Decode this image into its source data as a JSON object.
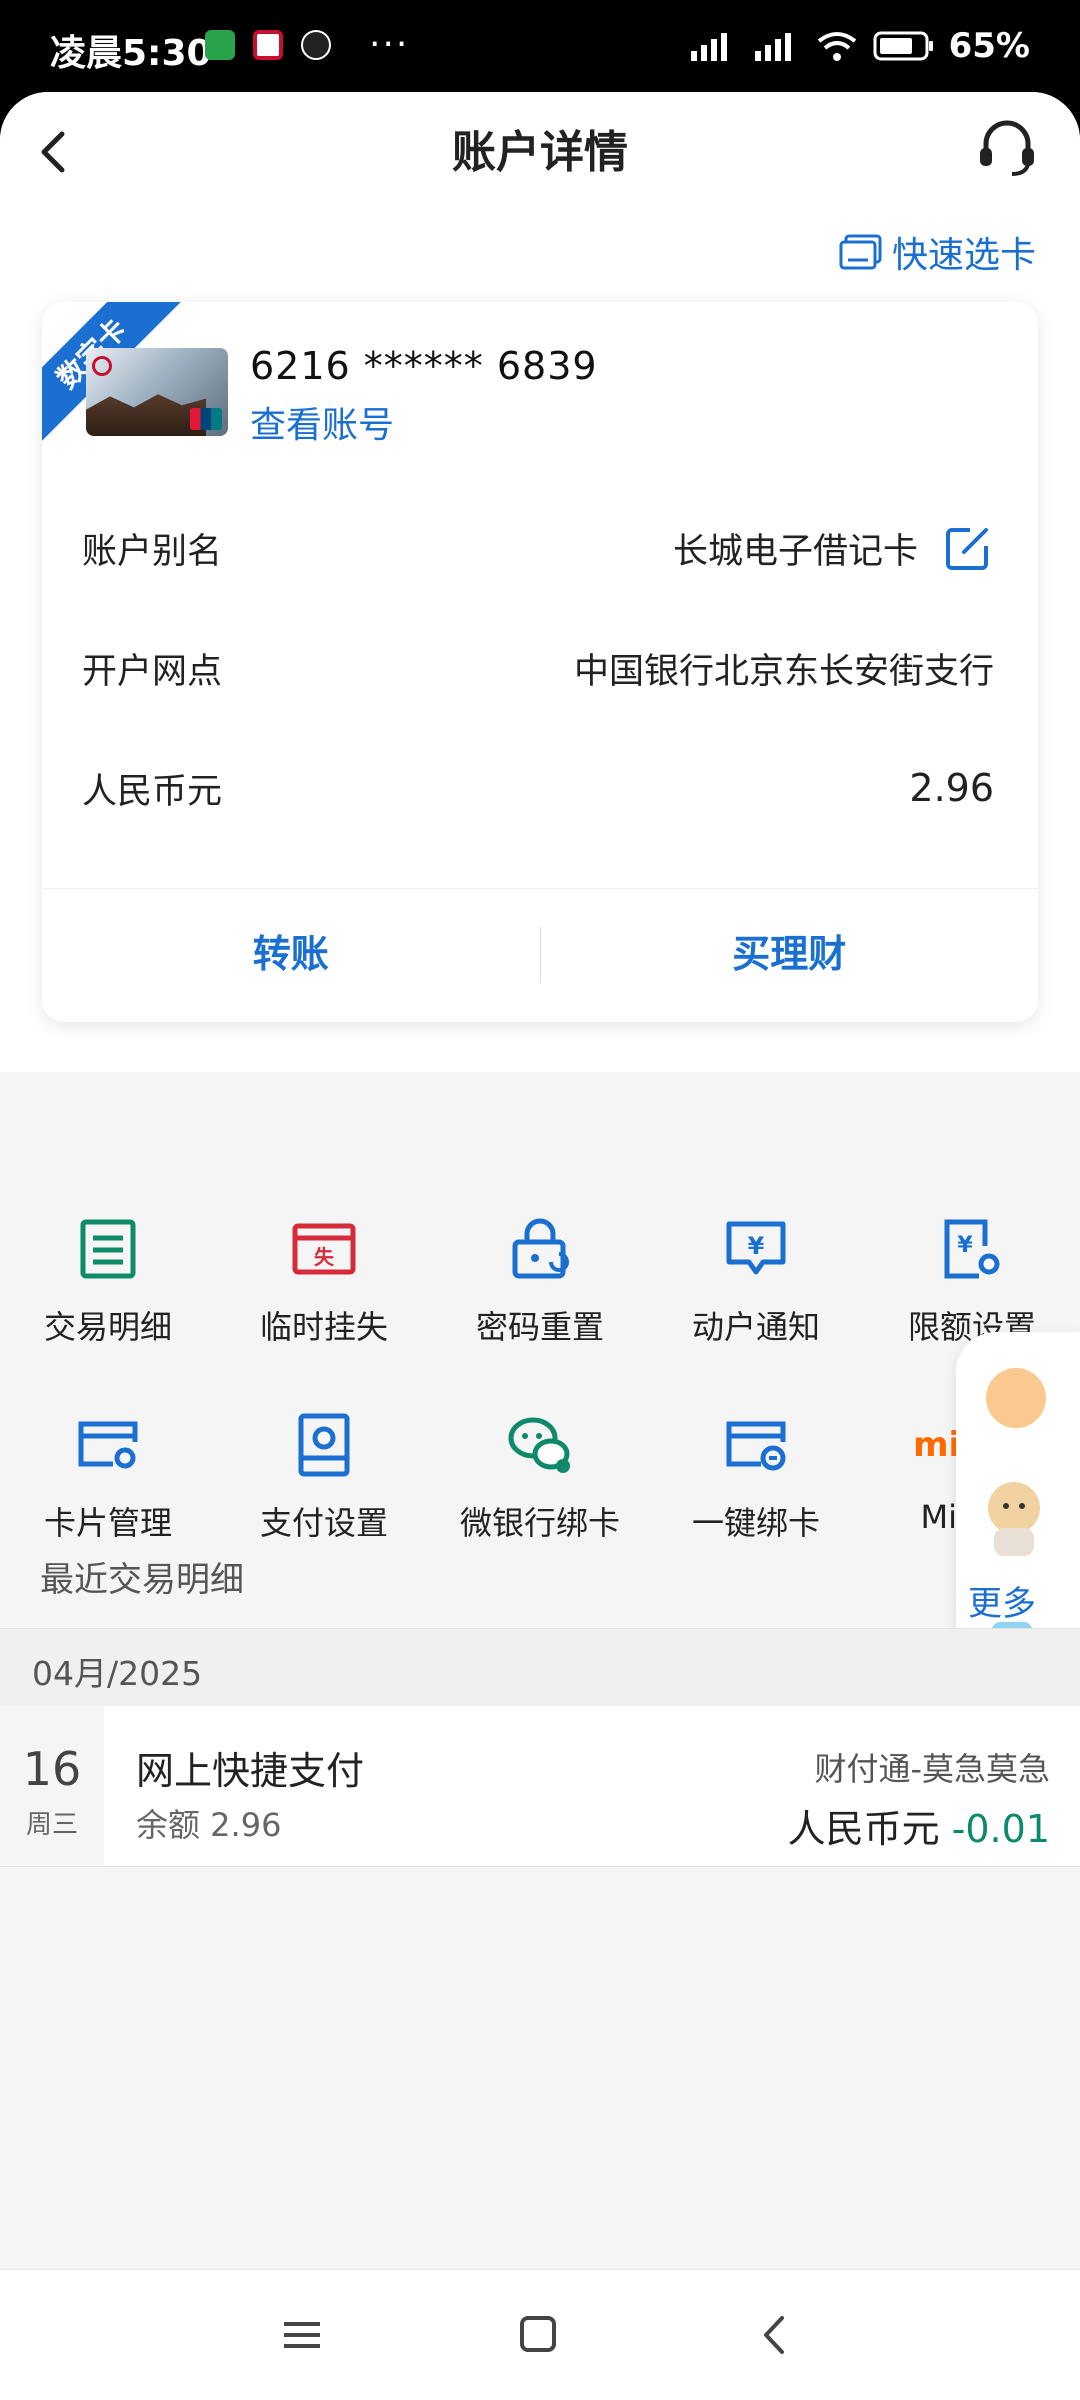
{
  "status_bar": {
    "time": "凌晨5:30",
    "battery": "65%"
  },
  "header": {
    "title": "账户详情",
    "quick_pick": "快速选卡"
  },
  "card": {
    "badge": "数字卡",
    "number": "6216 ****** 6839",
    "view_account": "查看账号",
    "rows": [
      {
        "label": "账户别名",
        "value": "长城电子借记卡"
      },
      {
        "label": "开户网点",
        "value": "中国银行北京东长安街支行"
      },
      {
        "label": "人民币元",
        "value": "2.96"
      }
    ],
    "actions": [
      "转账",
      "买理财"
    ]
  },
  "functions": [
    {
      "label": "交易明细",
      "icon": "list-icon"
    },
    {
      "label": "临时挂失",
      "icon": "report-loss-icon"
    },
    {
      "label": "密码重置",
      "icon": "lock-reset-icon"
    },
    {
      "label": "动户通知",
      "icon": "notice-icon"
    },
    {
      "label": "限额设置",
      "icon": "limit-settings-icon"
    },
    {
      "label": "卡片管理",
      "icon": "card-manage-icon"
    },
    {
      "label": "支付设置",
      "icon": "payment-settings-icon"
    },
    {
      "label": "微银行绑卡",
      "icon": "wechat-icon"
    },
    {
      "label": "一键绑卡",
      "icon": "bind-card-icon"
    },
    {
      "label": "Mi Pay",
      "icon": "mi-pay-icon"
    }
  ],
  "float_panel": {
    "more": "更多"
  },
  "recent": {
    "title": "最近交易明细",
    "month": "04月/2025",
    "transactions": [
      {
        "day": "16",
        "weekday": "周三",
        "title": "网上快捷支付",
        "balance": "余额 2.96",
        "counterparty": "财付通-莫急莫急",
        "currency": "人民币元",
        "amount": "-0.01"
      }
    ]
  },
  "colors": {
    "accent": "#1a6fd1",
    "negative": "#0a8a6a",
    "green_icon": "#0e8a6a",
    "red_icon": "#d62b3a"
  }
}
